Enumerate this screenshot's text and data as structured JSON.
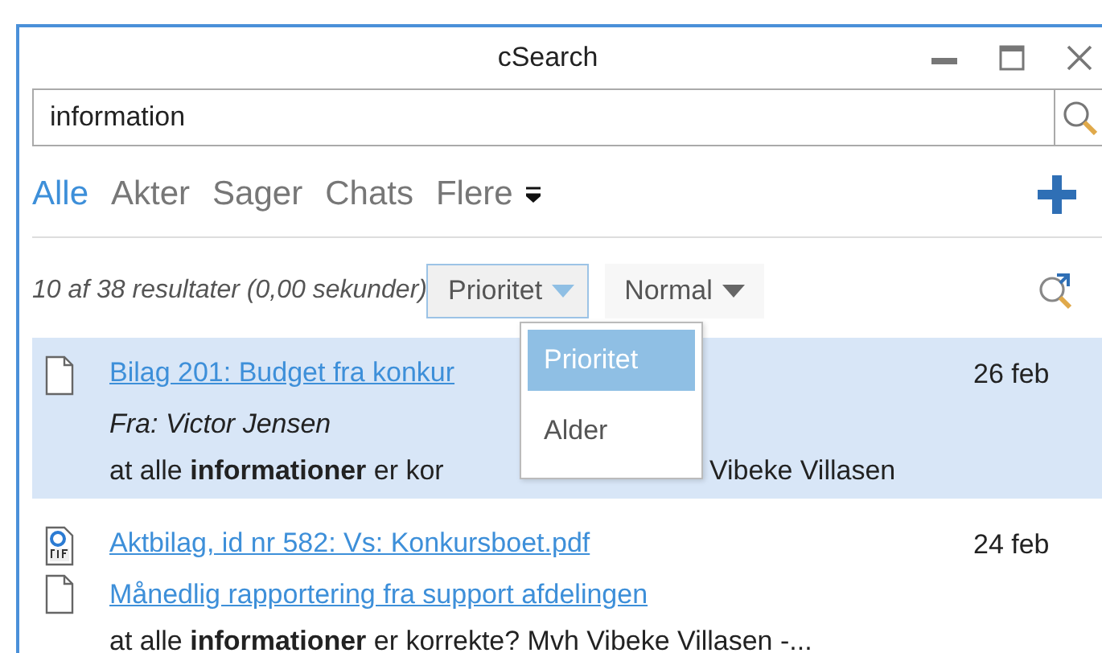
{
  "window": {
    "title": "cSearch"
  },
  "search": {
    "value": "information"
  },
  "tabs": [
    {
      "label": "Alle",
      "selected": true
    },
    {
      "label": "Akter",
      "selected": false
    },
    {
      "label": "Sager",
      "selected": false
    },
    {
      "label": "Chats",
      "selected": false
    },
    {
      "label": "Flere",
      "selected": false,
      "kind": "menu"
    }
  ],
  "results": {
    "summary": "10 af 38 resultater (0,00 sekunder)",
    "sort": {
      "label": "Prioritet",
      "expanded": true,
      "options": [
        {
          "label": "Prioritet",
          "selected": true
        },
        {
          "label": "Alder",
          "selected": false
        }
      ]
    },
    "mode": {
      "label": "Normal"
    }
  },
  "items": [
    {
      "selected": true,
      "date": "26 feb",
      "lines": [
        {
          "kind": "document-link",
          "text": "Bilag 201: Budget fra konkur"
        },
        {
          "kind": "from",
          "text": "Fra: Victor Jensen"
        },
        {
          "kind": "snippet",
          "text": "at alle **informationer** er kor",
          "tail": "Vibeke Villasen"
        }
      ]
    },
    {
      "selected": false,
      "date": "24 feb",
      "lines": [
        {
          "kind": "pdf-link",
          "text": "Aktbilag, id nr 582: Vs: Konkursboet.pdf"
        },
        {
          "kind": "document-link",
          "text": "Månedlig rapportering fra support afdelingen"
        },
        {
          "kind": "snippet",
          "text": "at alle **informationer** er korrekte? Mvh Vibeke Villasen -..."
        }
      ]
    }
  ]
}
